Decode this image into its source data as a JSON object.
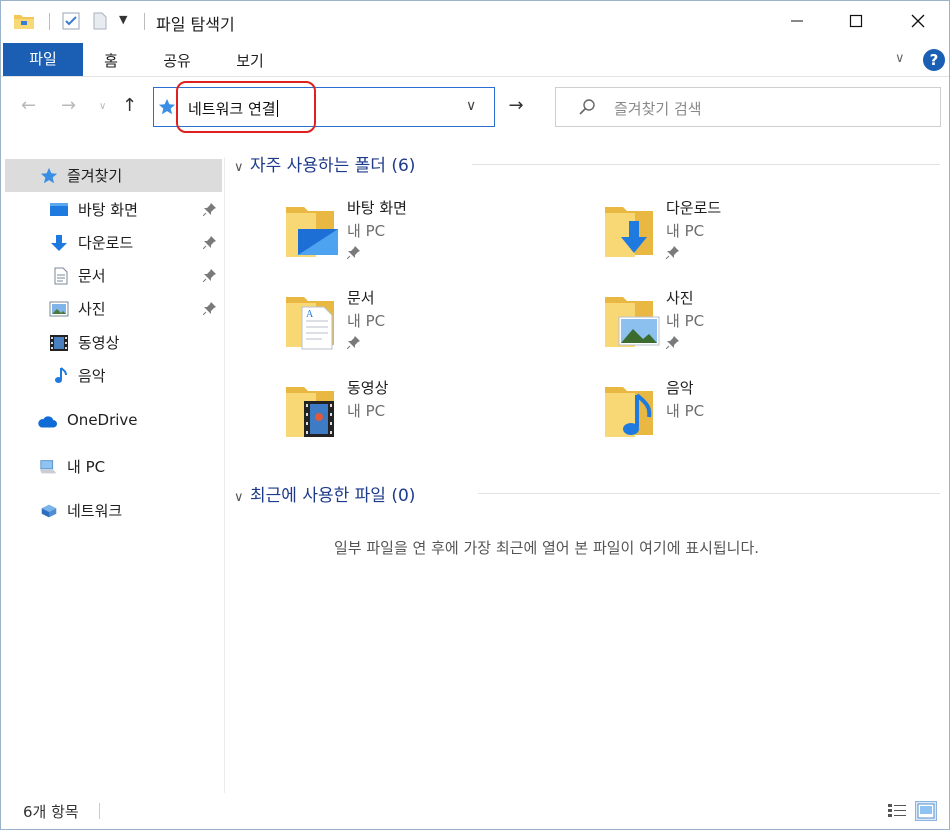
{
  "window": {
    "title": "파일 탐색기"
  },
  "ribbon": {
    "tabs": [
      "파일",
      "홈",
      "공유",
      "보기"
    ]
  },
  "address": {
    "value": "네트워크 연결"
  },
  "search": {
    "placeholder": "즐겨찾기 검색"
  },
  "nav": {
    "items": [
      {
        "label": "즐겨찾기",
        "icon": "star-icon"
      },
      {
        "label": "바탕 화면",
        "icon": "desktop-icon"
      },
      {
        "label": "다운로드",
        "icon": "download-icon"
      },
      {
        "label": "문서",
        "icon": "document-icon"
      },
      {
        "label": "사진",
        "icon": "pictures-icon"
      },
      {
        "label": "동영상",
        "icon": "video-icon"
      },
      {
        "label": "음악",
        "icon": "music-icon"
      },
      {
        "label": "OneDrive",
        "icon": "cloud-icon"
      },
      {
        "label": "내 PC",
        "icon": "computer-icon"
      },
      {
        "label": "네트워크",
        "icon": "network-icon"
      }
    ]
  },
  "frequent": {
    "header": "자주 사용하는 폴더 (6)",
    "items": [
      {
        "name": "바탕 화면",
        "location": "내 PC"
      },
      {
        "name": "다운로드",
        "location": "내 PC"
      },
      {
        "name": "문서",
        "location": "내 PC"
      },
      {
        "name": "사진",
        "location": "내 PC"
      },
      {
        "name": "동영상",
        "location": "내 PC"
      },
      {
        "name": "음악",
        "location": "내 PC"
      }
    ]
  },
  "recent": {
    "header": "최근에 사용한 파일 (0)",
    "empty_message": "일부 파일을 연 후에 가장 최근에 열어 본 파일이 여기에 표시됩니다."
  },
  "status": {
    "item_count": "6개 항목"
  },
  "colors": {
    "accent": "#1a5fb4",
    "highlight": "#e02020",
    "folder": "#f5d57a",
    "header_text": "#1e3a8a"
  }
}
